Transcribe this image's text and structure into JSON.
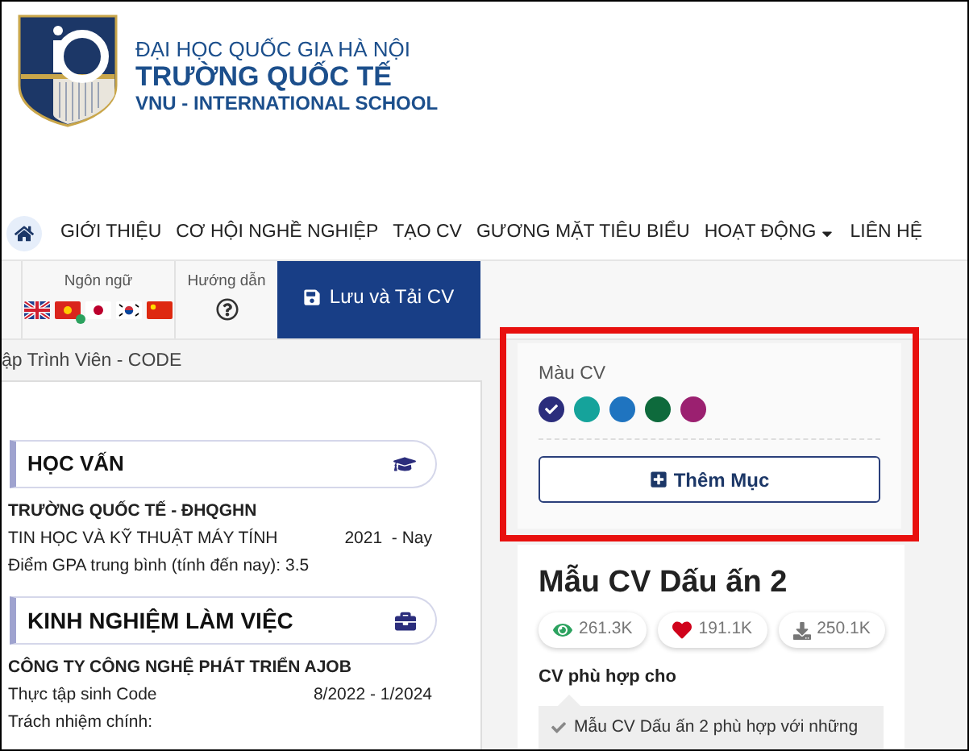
{
  "logo": {
    "line_1": "ĐẠI HỌC QUỐC GIA HÀ NỘI",
    "line_2": "TRƯỜNG QUỐC TẾ",
    "line_3": "VNU - INTERNATIONAL SCHOOL"
  },
  "nav": [
    {
      "kind": "home",
      "selected": true
    },
    {
      "kind": "link",
      "label": "GIỚI THIỆU",
      "selected": false
    },
    {
      "kind": "link",
      "label": "CƠ HỘI NGHỀ NGHIỆP",
      "selected": false
    },
    {
      "kind": "link",
      "label": "TẠO CV",
      "selected": false
    },
    {
      "kind": "link",
      "label": "GƯƠNG MẶT TIÊU BIỂU",
      "selected": false
    },
    {
      "kind": "menu",
      "label": "HOẠT ĐỘNG",
      "selected": false
    },
    {
      "kind": "link",
      "label": "LIÊN HỆ",
      "selected": false
    }
  ],
  "toolbar": {
    "language": {
      "label": "Ngôn ngữ",
      "flags": [
        {
          "kind": "uk",
          "selected": false
        },
        {
          "kind": "vn",
          "selected": true
        },
        {
          "kind": "jp",
          "selected": false
        },
        {
          "kind": "kr",
          "selected": false
        },
        {
          "kind": "cn",
          "selected": false
        }
      ]
    },
    "guide": {
      "label": "Hướng dẫn"
    },
    "save_button": "Lưu và Tải CV"
  },
  "cv": {
    "title": "ập Trình Viên - CODE",
    "sections": [
      {
        "heading": "HỌC VẤN",
        "kind": "education",
        "org": "TRƯỜNG QUỐC TẾ - ĐHQGHN",
        "role": "TIN HỌC VÀ KỸ THUẬT MÁY TÍNH",
        "period": "2021  - Nay",
        "note": "Điểm GPA trung bình (tính đến nay): 3.5"
      },
      {
        "heading": "KINH NGHIỆM LÀM VIỆC",
        "kind": "work",
        "org": "CÔNG TY CÔNG NGHỆ PHÁT TRIỂN AJOB",
        "role": "Thực tập sinh Code",
        "period": "8/2022 - 1/2024",
        "note": "Trách nhiệm chính:"
      }
    ]
  },
  "sidebar": {
    "color_picker": {
      "label": "Màu CV",
      "colors": [
        {
          "color": "#2b2d7c",
          "selected": true
        },
        {
          "color": "#15a39b",
          "selected": false
        },
        {
          "color": "#1f74c0",
          "selected": false
        },
        {
          "color": "#0e6a3c",
          "selected": false
        },
        {
          "color": "#9b2070",
          "selected": false
        }
      ]
    },
    "add_button": "Thêm Mục",
    "template": {
      "title": "Mẫu CV Dấu ấn 2",
      "stats": [
        {
          "kind": "views",
          "value": "261.3K"
        },
        {
          "kind": "likes",
          "value": "191.1K"
        },
        {
          "kind": "downloads",
          "value": "250.1K"
        }
      ],
      "fit_heading": "CV phù hợp cho",
      "fit_items": [
        "Mẫu CV Dấu ấn 2 phù hợp với những"
      ]
    }
  }
}
